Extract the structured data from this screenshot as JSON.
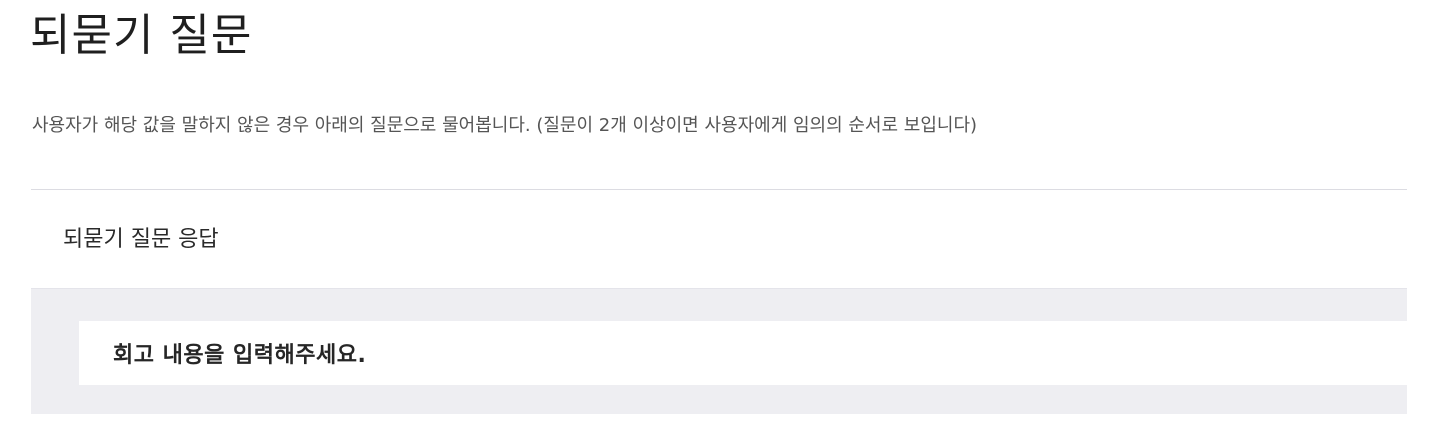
{
  "header": {
    "title": "되묻기 질문",
    "description": "사용자가 해당 값을 말하지 않은 경우 아래의 질문으로 물어봅니다. (질문이 2개 이상이면 사용자에게 임의의 순서로 보입니다)"
  },
  "panel": {
    "title": "되묻기 질문 응답",
    "responses": [
      {
        "text": "회고 내용을 입력해주세요."
      }
    ]
  }
}
